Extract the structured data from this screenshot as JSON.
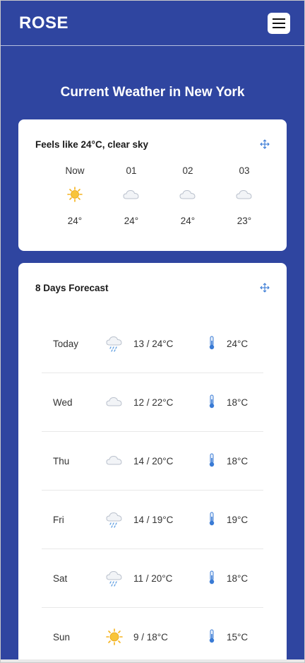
{
  "header": {
    "brand": "ROSE",
    "menu_icon": "hamburger-icon"
  },
  "title": "Current Weather in New York",
  "current": {
    "summary": "Feels like 24°C, clear sky",
    "move_icon": "move-arrows-icon",
    "hours": [
      {
        "label": "Now",
        "icon": "sun-icon",
        "temp": "24°"
      },
      {
        "label": "01",
        "icon": "cloud-icon",
        "temp": "24°"
      },
      {
        "label": "02",
        "icon": "cloud-icon",
        "temp": "24°"
      },
      {
        "label": "03",
        "icon": "cloud-icon",
        "temp": "23°"
      }
    ]
  },
  "forecast": {
    "title": "8 Days Forecast",
    "move_icon": "move-arrows-icon",
    "days": [
      {
        "day": "Today",
        "icon": "rain-cloud-icon",
        "range": "13 / 24°C",
        "feels": "24°C"
      },
      {
        "day": "Wed",
        "icon": "cloud-icon",
        "range": "12 / 22°C",
        "feels": "18°C"
      },
      {
        "day": "Thu",
        "icon": "cloud-icon",
        "range": "14 / 20°C",
        "feels": "18°C"
      },
      {
        "day": "Fri",
        "icon": "rain-cloud-icon",
        "range": "14 / 19°C",
        "feels": "19°C"
      },
      {
        "day": "Sat",
        "icon": "rain-cloud-icon",
        "range": "11 / 20°C",
        "feels": "18°C"
      },
      {
        "day": "Sun",
        "icon": "sun-icon",
        "range": "9 / 18°C",
        "feels": "15°C"
      }
    ]
  },
  "colors": {
    "background": "#2f45a0",
    "card": "#ffffff",
    "accent": "#3a7bd5",
    "sun": "#f5b21a"
  }
}
